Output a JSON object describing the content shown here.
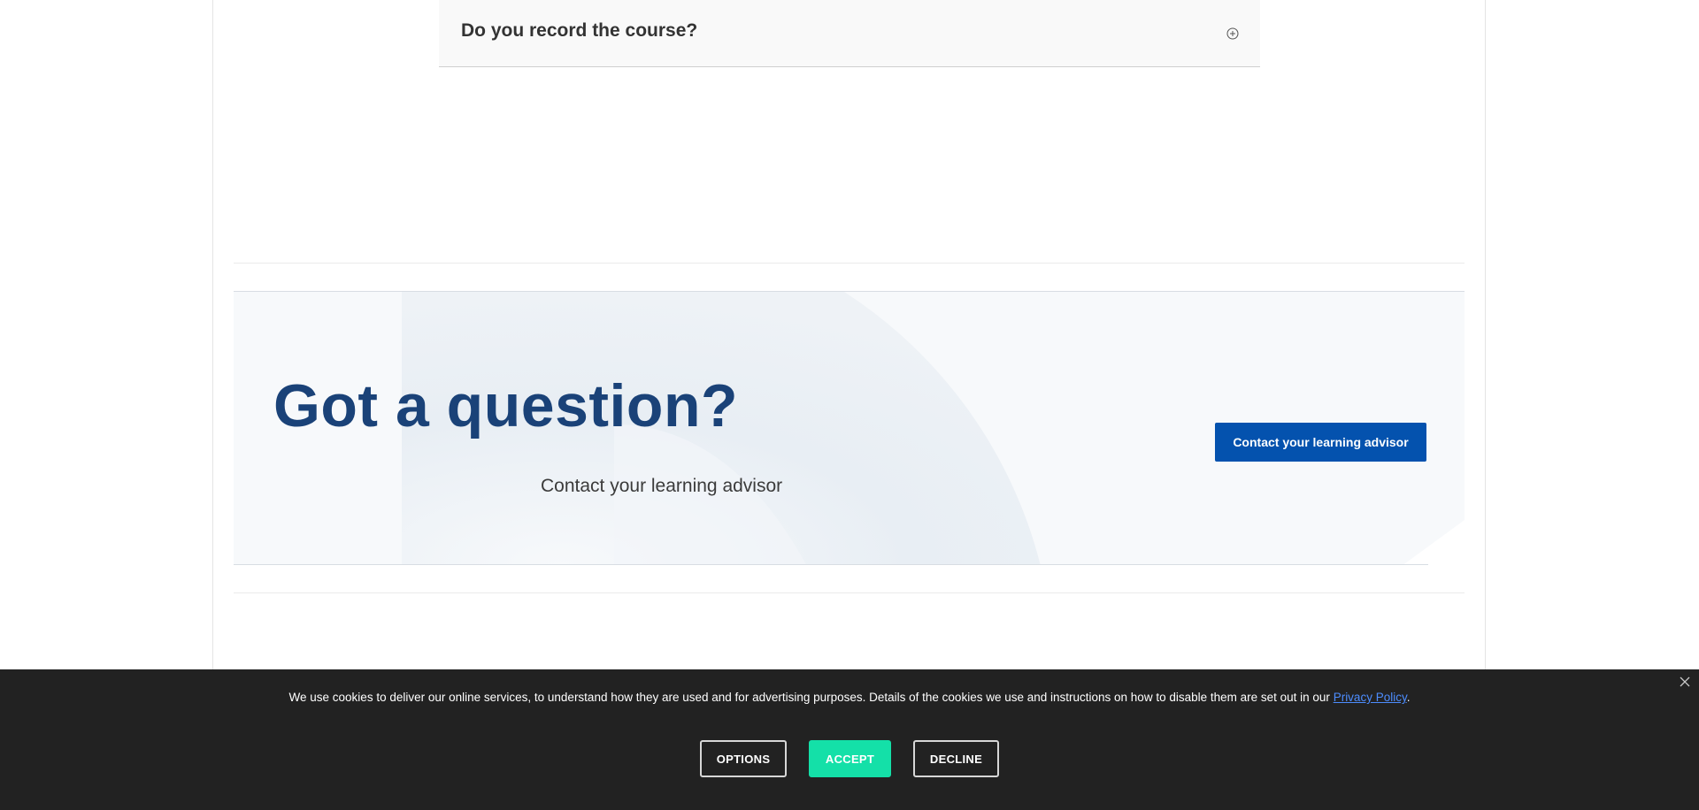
{
  "faq": {
    "question": "Do you record the course?",
    "toggle_icon": "plus-circle-icon"
  },
  "cta": {
    "title": "Got a question?",
    "subtitle": "Contact your learning advisor",
    "button_label": "Contact your learning advisor",
    "title_color": "#1a4278",
    "button_color": "#0452ae"
  },
  "cookie_banner": {
    "text_before_link": "We use cookies to deliver our online services, to understand how they are used and for advertising purposes. Details of the cookies we use and instructions on how to disable them are set out in our ",
    "link_label": "Privacy Policy",
    "text_after_link": ".",
    "options_label": "OPTIONS",
    "accept_label": "ACCEPT",
    "decline_label": "DECLINE",
    "close_icon": "close-icon",
    "accept_color": "#14e0a8",
    "background_color": "#222222"
  }
}
